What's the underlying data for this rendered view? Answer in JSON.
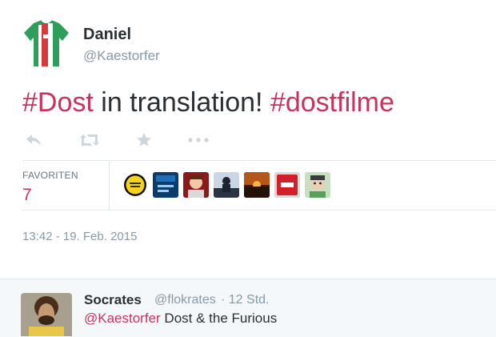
{
  "tweet": {
    "author_name": "Daniel",
    "author_handle": "@Kaestorfer",
    "text_parts": [
      "#Dost",
      " in translation! ",
      "#dostfilme"
    ],
    "timestamp": "13:42 - 19. Feb. 2015"
  },
  "actions": {
    "icons": [
      "reply-icon",
      "retweet-icon",
      "favorite-icon",
      "more-icon"
    ]
  },
  "stats": {
    "favorites_label": "FAVORITEN",
    "favorites_count": "7",
    "favoriter_avatars": [
      "avatar-yellow-badge",
      "avatar-blue-poster",
      "avatar-red-cartoon",
      "avatar-dark-silhouette",
      "avatar-sunset",
      "avatar-red-logo",
      "avatar-cartoon-face"
    ]
  },
  "reply": {
    "name": "Socrates",
    "handle": "@flokrates",
    "time": "· 12 Std.",
    "mention": "@Kaestorfer",
    "text": " Dost & the Furious"
  },
  "colors": {
    "accent": "#c8335b",
    "muted": "#8899a6",
    "text": "#292f33",
    "divider": "#e1e8ed",
    "reply_bg": "#f5f8fa"
  }
}
